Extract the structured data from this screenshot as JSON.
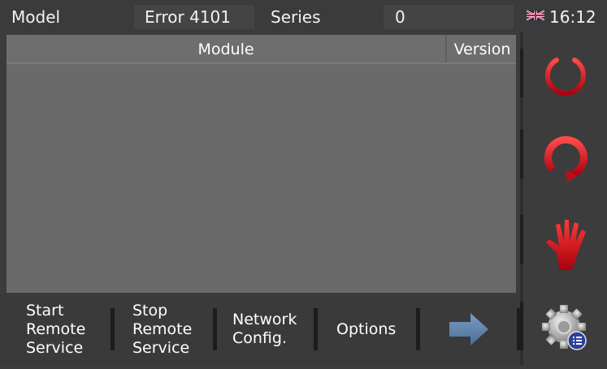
{
  "header": {
    "model_label": "Model",
    "model_value": "Error 4101",
    "series_label": "Series",
    "series_value": "0"
  },
  "status": {
    "language_flag": "uk-flag-icon",
    "time": "16:12"
  },
  "table": {
    "columns": [
      "Module",
      "Version"
    ],
    "rows": []
  },
  "side_buttons": [
    {
      "name": "power",
      "icon": "power-icon",
      "color": "#d9141c"
    },
    {
      "name": "restart",
      "icon": "restart-icon",
      "color": "#d9141c"
    },
    {
      "name": "stop",
      "icon": "stop-hand-icon",
      "color": "#d9141c"
    },
    {
      "name": "settings",
      "icon": "gear-icon",
      "color": "#9a9a9a"
    }
  ],
  "toolbar": {
    "start_remote": "Start\nRemote\nService",
    "stop_remote": "Stop\nRemote\nService",
    "network_config": "Network\nConfig.",
    "options": "Options",
    "next_icon": "arrow-right-icon"
  },
  "colors": {
    "panel": "#6a6a6a",
    "background": "#3c3c3c",
    "accent_red": "#d9141c",
    "arrow_blue": "#5a7fa8"
  }
}
